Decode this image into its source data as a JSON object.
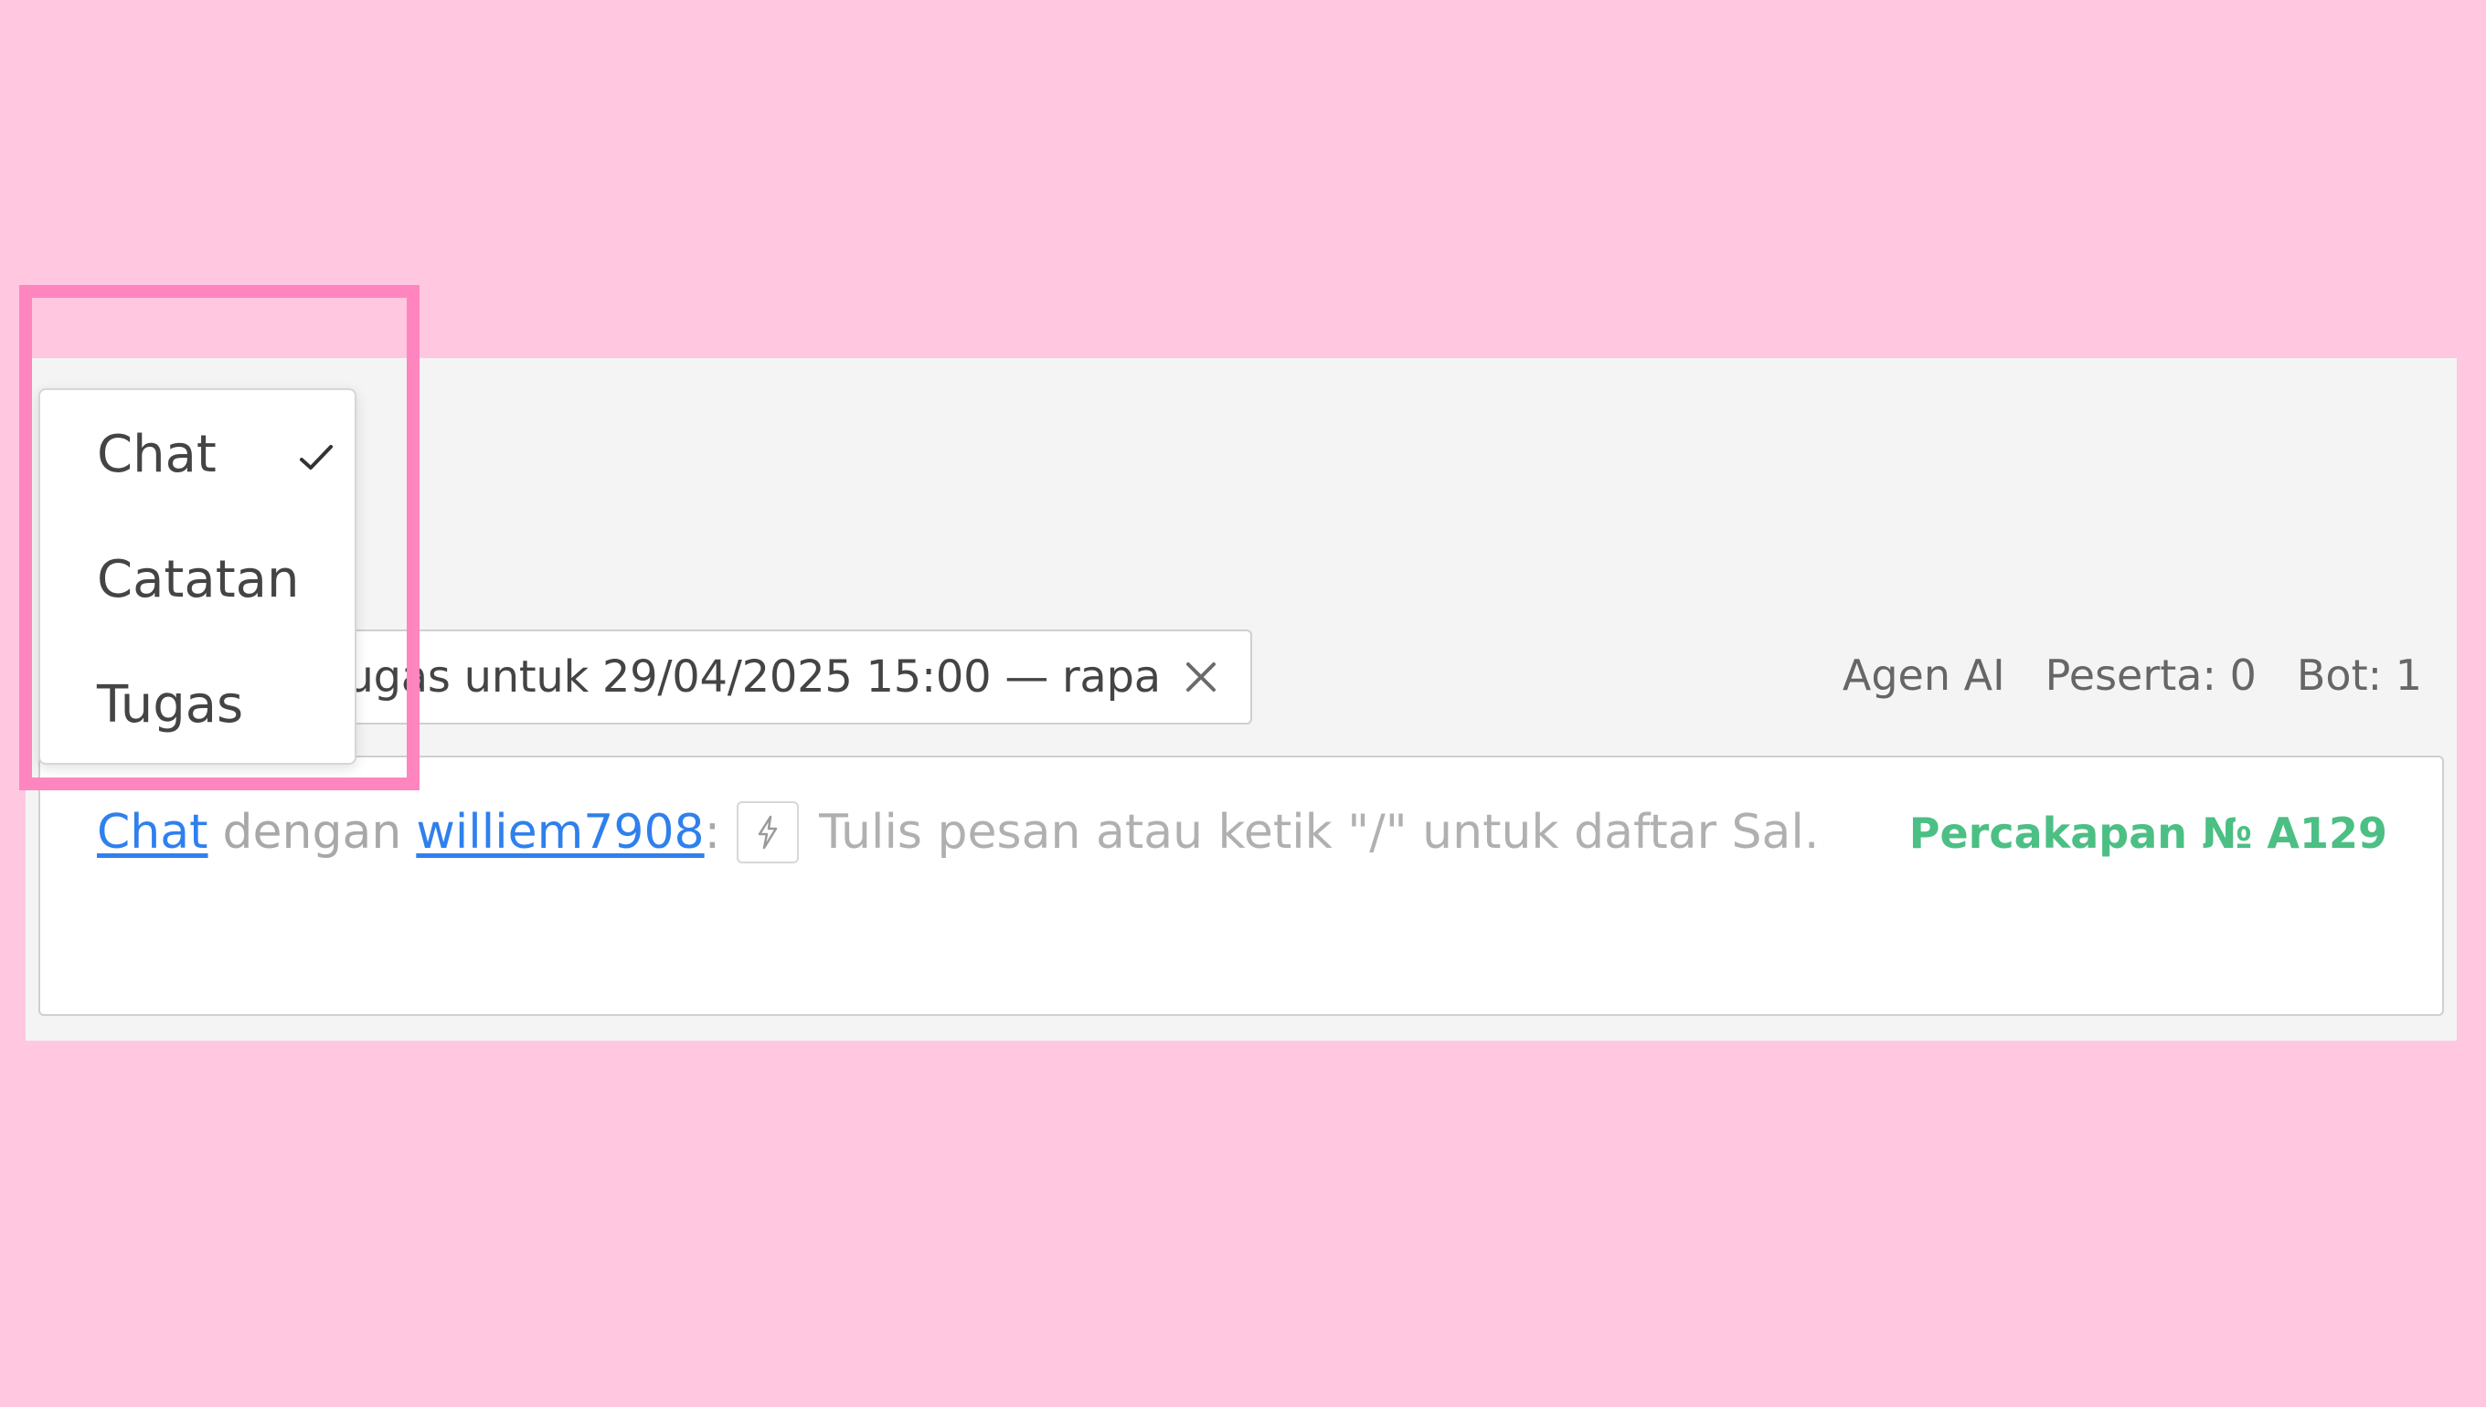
{
  "colors": {
    "backdrop": "#ffc8e0",
    "panel": "#f4f4f4",
    "link": "#2f80ed",
    "conversation_id": "#4cbf84",
    "highlight_frame": "#ff85bf"
  },
  "mode_menu": {
    "items": [
      {
        "label": "Chat",
        "selected": true
      },
      {
        "label": "Catatan",
        "selected": false
      },
      {
        "label": "Tugas",
        "selected": false
      }
    ],
    "check_icon": "checkmark-icon"
  },
  "task_chip": {
    "text": "tugas untuk 29/04/2025 15:00 — rapat",
    "close_icon": "close-icon"
  },
  "stats": {
    "ai_agent": "Agen AI",
    "participants": "Peserta: 0",
    "bots": "Bot: 1"
  },
  "composer": {
    "mode_link": "Chat",
    "with_text": "dengan",
    "user_link": "williem7908",
    "colon": ":",
    "bolt_icon": "lightning-icon",
    "placeholder": "Tulis pesan atau ketik \"/\" untuk daftar Sal...",
    "conversation_id": "Percakapan № A129"
  }
}
